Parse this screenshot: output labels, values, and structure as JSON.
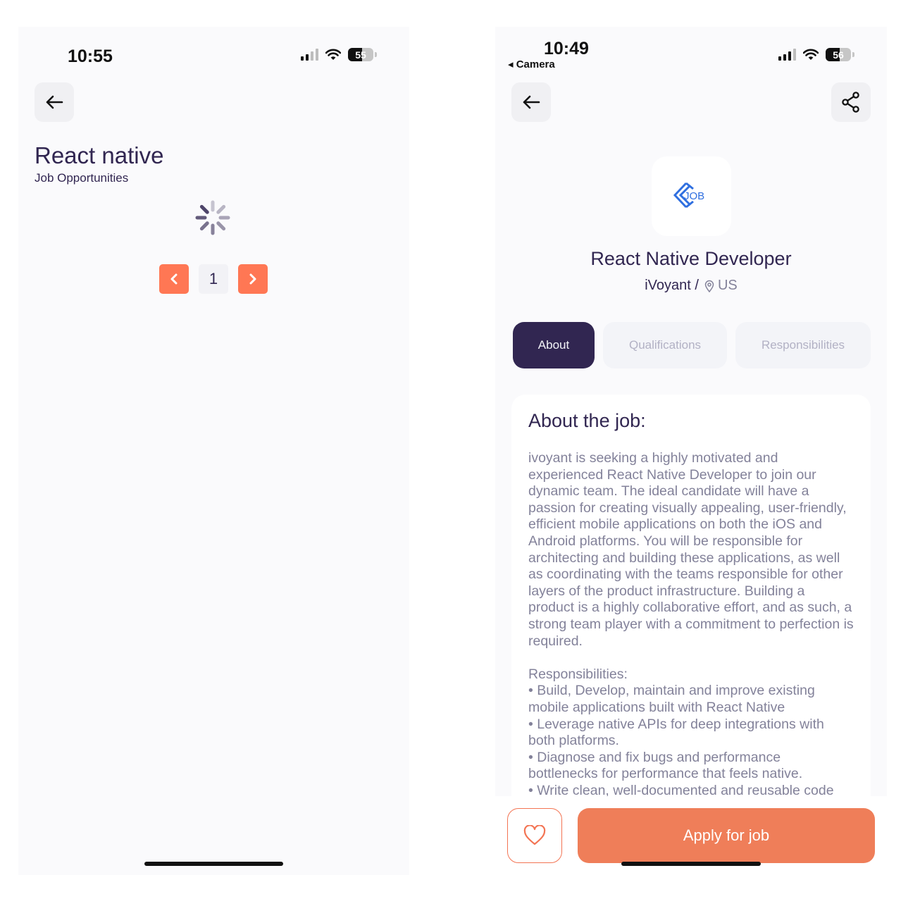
{
  "left_screen": {
    "status": {
      "time": "10:55",
      "battery": "55"
    },
    "title": "React native",
    "subtitle": "Job Opportunities",
    "pagination": {
      "current_page": "1"
    }
  },
  "right_screen": {
    "status": {
      "time": "10:49",
      "back_app_label": "◂ Camera",
      "battery": "56"
    },
    "job": {
      "logo_text": "JOB",
      "title": "React Native Developer",
      "company": "iVoyant /",
      "location": "US"
    },
    "tabs": [
      {
        "label": "About",
        "active": true
      },
      {
        "label": "Qualifications",
        "active": false
      },
      {
        "label": "Responsibilities",
        "active": false
      }
    ],
    "about": {
      "heading": "About the job:",
      "body": "ivoyant is seeking a highly motivated and experienced React Native Developer to join our dynamic team. The ideal candidate will have a passion for creating visually appealing, user-friendly, efficient mobile applications on both the iOS and Android platforms. You will be responsible for architecting and building these applications, as well as coordinating with the teams responsible for other layers of the product infrastructure. Building a product is a highly collaborative effort, and as such, a strong team player with a commitment to perfection is required.\n\nResponsibilities:\n• Build, Develop, maintain and improve existing mobile applications built with React Native\n• Leverage native APIs for deep integrations with both platforms.\n• Diagnose and fix bugs and performance bottlenecks for performance that feels native.\n• Write clean, well-documented and reusable code"
    },
    "footer": {
      "apply_label": "Apply for job"
    }
  },
  "colors": {
    "primary": "#312651",
    "accent": "#ff7754",
    "gray": "#83829a",
    "tab_bg": "#f3f4f8",
    "logo_blue": "#2f6fe0"
  },
  "icons": [
    "arrow-left-icon",
    "share-icon",
    "heart-icon",
    "location-pin-icon",
    "chevron-left-icon",
    "chevron-right-icon",
    "spinner-icon",
    "wifi-icon",
    "signal-icon",
    "battery-icon",
    "job-logo-icon"
  ]
}
